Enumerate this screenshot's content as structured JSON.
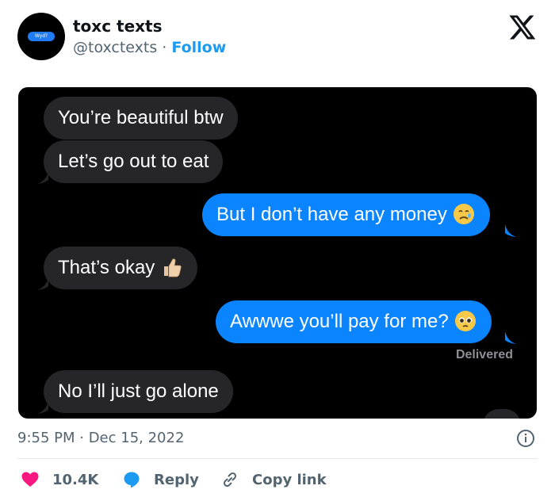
{
  "tweet": {
    "author_name": "toxc texts",
    "author_handle": "@toxctexts",
    "separator": " · ",
    "follow_label": "Follow",
    "avatar_text": "Wyd?",
    "timestamp": "9:55 PM · Dec 15, 2022"
  },
  "chat": {
    "messages": [
      {
        "side": "incoming",
        "text": "You’re beautiful btw"
      },
      {
        "side": "incoming",
        "text": "Let’s go out to eat"
      },
      {
        "side": "outgoing",
        "text": "But I don’t have any money",
        "emoji": "crying-face"
      },
      {
        "side": "incoming",
        "text": "That’s okay",
        "emoji": "thumbs-up"
      },
      {
        "side": "outgoing",
        "text": "Awwwe you’ll pay for me?",
        "emoji": "pleading-face"
      },
      {
        "side": "incoming",
        "text": "No I’ll just go alone"
      }
    ],
    "delivered_label": "Delivered"
  },
  "actions": {
    "likes_count": "10.4K",
    "reply_label": "Reply",
    "copy_link_label": "Copy link"
  },
  "colors": {
    "link": "#1d9bf0",
    "like": "#f91880",
    "outgoing_bubble": "#0a84ff",
    "incoming_bubble": "#262628"
  },
  "icons": [
    "x-logo-icon",
    "info-icon",
    "heart-icon",
    "reply-bubble-icon",
    "link-icon"
  ]
}
